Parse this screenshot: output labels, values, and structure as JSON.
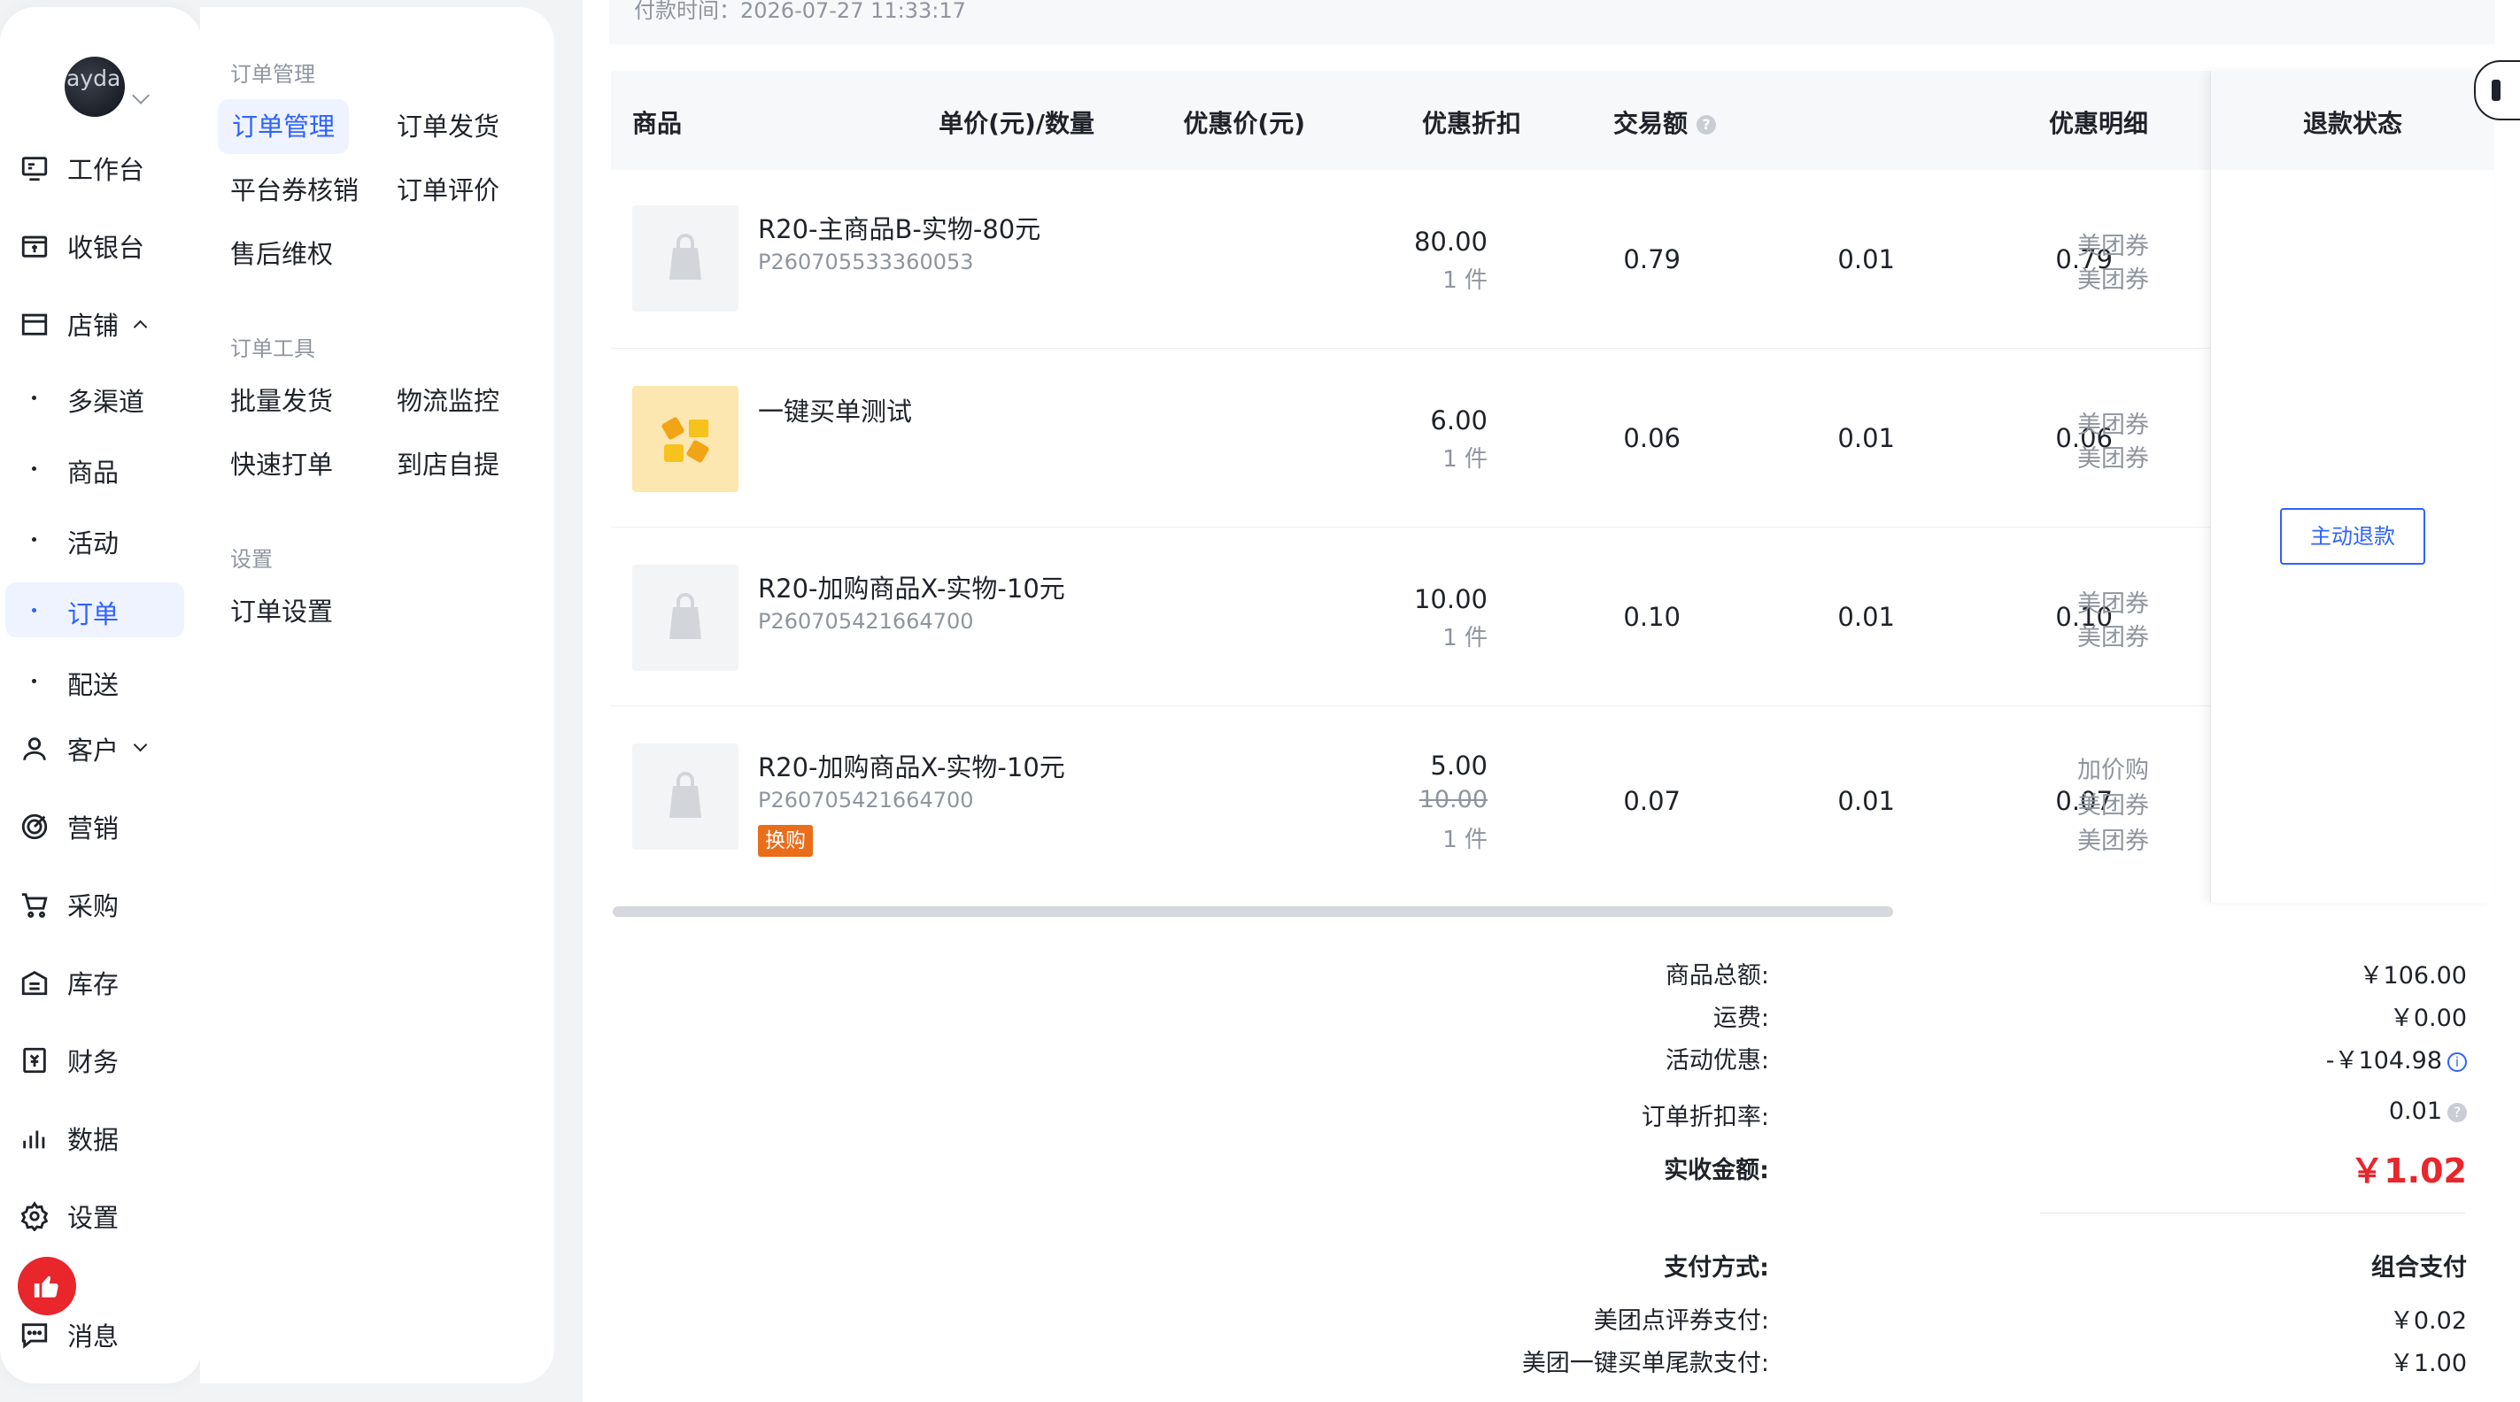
{
  "nav": {
    "items": [
      {
        "label": "工作台",
        "icon": "workbench-icon"
      },
      {
        "label": "收银台",
        "icon": "cashier-icon"
      },
      {
        "label": "店铺",
        "icon": "store-icon"
      },
      {
        "label": "客户",
        "icon": "customer-icon"
      },
      {
        "label": "营销",
        "icon": "marketing-icon"
      },
      {
        "label": "采购",
        "icon": "cart-icon"
      },
      {
        "label": "库存",
        "icon": "warehouse-icon"
      },
      {
        "label": "财务",
        "icon": "finance-icon"
      },
      {
        "label": "数据",
        "icon": "data-chart-icon"
      },
      {
        "label": "设置",
        "icon": "settings-icon"
      },
      {
        "label": "消息",
        "icon": "message-icon"
      }
    ],
    "store_sub": [
      "多渠道",
      "商品",
      "活动",
      "订单",
      "配送"
    ],
    "active_sub": "订单"
  },
  "submenu": {
    "group1": {
      "title": "订单管理",
      "links": [
        "订单管理",
        "订单发货",
        "平台券核销",
        "订单评价",
        "售后维权"
      ]
    },
    "group2": {
      "title": "订单工具",
      "links": [
        "批量发货",
        "物流监控",
        "快速打单",
        "到店自提"
      ]
    },
    "group3": {
      "title": "设置",
      "links": [
        "订单设置"
      ]
    }
  },
  "order": {
    "pay_time": "付款时间：2026-07-27 11:33:17",
    "headers": {
      "product": "商品",
      "unit_price_qty": "单价(元)/数量",
      "promo_price": "优惠价(元)",
      "discount": "优惠折扣",
      "amount": "交易额",
      "promo_detail": "优惠明细",
      "refund_status": "退款状态"
    },
    "rows": [
      {
        "name": "R20-主商品B-实物-80元",
        "code": "P260705533360053",
        "price": "80.00",
        "qty": "1 件",
        "promo_price": "0.79",
        "discount": "0.01",
        "amount": "0.79",
        "details": [
          "美团券",
          "美团券"
        ]
      },
      {
        "name": "一键买单测试",
        "code": "",
        "price": "6.00",
        "qty": "1 件",
        "promo_price": "0.06",
        "discount": "0.01",
        "amount": "0.06",
        "details": [
          "美团券",
          "美团券"
        ]
      },
      {
        "name": "R20-加购商品X-实物-10元",
        "code": "P260705421664700",
        "price": "10.00",
        "qty": "1 件",
        "promo_price": "0.10",
        "discount": "0.01",
        "amount": "0.10",
        "details": [
          "美团券",
          "美团券"
        ]
      },
      {
        "name": "R20-加购商品X-实物-10元",
        "code": "P260705421664700",
        "tag": "换购",
        "price": "5.00",
        "orig_price": "10.00",
        "qty": "1 件",
        "promo_price": "0.07",
        "discount": "0.01",
        "amount": "0.07",
        "details": [
          "加价购",
          "美团券",
          "美团券"
        ]
      }
    ],
    "refund_button": "主动退款"
  },
  "summary": {
    "goods_total_label": "商品总额:",
    "goods_total": "￥106.00",
    "shipping_label": "运费:",
    "shipping": "￥0.00",
    "promo_label": "活动优惠:",
    "promo": "-￥104.98",
    "rate_label": "订单折扣率:",
    "rate": "0.01",
    "actual_label": "实收金额:",
    "actual": "￥1.02",
    "pay_method_label": "支付方式:",
    "pay_method": "组合支付",
    "pay1_label": "美团点评券支付:",
    "pay1": "￥0.02",
    "pay2_label": "美团一键买单尾款支付:",
    "pay2": "￥1.00"
  },
  "colors": {
    "accent": "#2f62ff",
    "price_red": "#e8262b",
    "tag_orange": "#ea6d19"
  }
}
